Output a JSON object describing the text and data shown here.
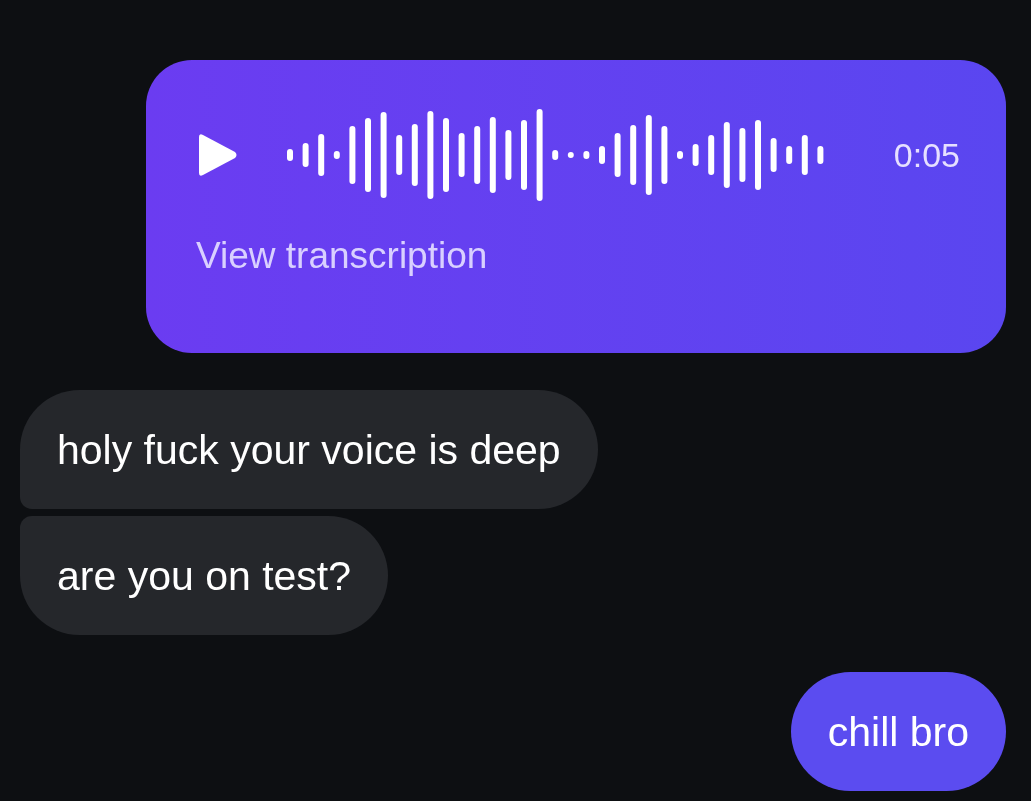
{
  "messages": [
    {
      "kind": "voice",
      "outgoing": true,
      "duration": "0:05",
      "action": "View transcription"
    },
    {
      "kind": "text",
      "outgoing": false,
      "text": "holy fuck your voice is deep"
    },
    {
      "kind": "text",
      "outgoing": false,
      "text": "are you on test?"
    },
    {
      "kind": "text",
      "outgoing": true,
      "text": "chill bro"
    }
  ]
}
